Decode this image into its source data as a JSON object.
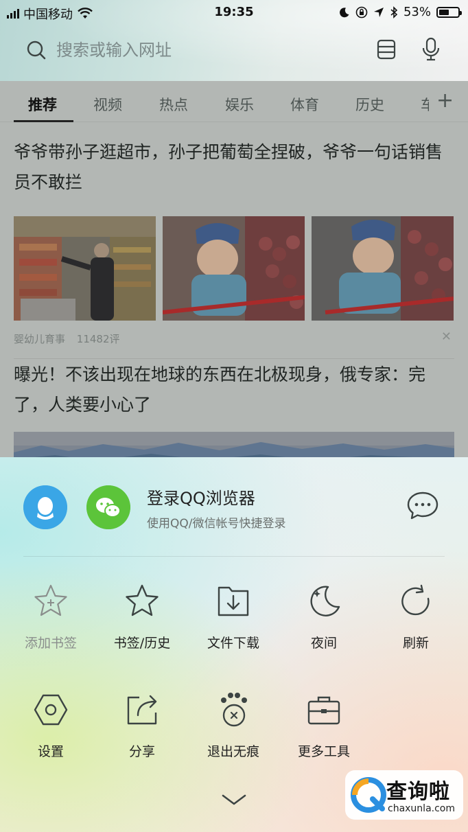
{
  "status_bar": {
    "carrier": "中国移动",
    "time": "19:35",
    "battery": "53%",
    "battery_level": 0.53
  },
  "search": {
    "placeholder": "搜索或输入网址"
  },
  "tabs": [
    {
      "label": "推荐",
      "active": true
    },
    {
      "label": "视频",
      "active": false
    },
    {
      "label": "热点",
      "active": false
    },
    {
      "label": "娱乐",
      "active": false
    },
    {
      "label": "体育",
      "active": false
    },
    {
      "label": "历史",
      "active": false
    },
    {
      "label": "车",
      "active": false
    }
  ],
  "feed": {
    "articles": [
      {
        "title": "爷爷带孙子逛超市，孙子把葡萄全捏破，爷爷一句话销售员不敢拦",
        "source": "婴幼儿育事",
        "comments": "11482评"
      },
      {
        "title": "曝光！不该出现在地球的东西在北极现身，俄专家：完了，人类要小心了"
      }
    ]
  },
  "login": {
    "title": "登录QQ浏览器",
    "subtitle": "使用QQ/微信帐号快捷登录"
  },
  "tools_row1": [
    {
      "label": "添加书签",
      "icon": "star-plus-icon",
      "enabled": false
    },
    {
      "label": "书签/历史",
      "icon": "star-icon",
      "enabled": true
    },
    {
      "label": "文件下载",
      "icon": "folder-download-icon",
      "enabled": true
    },
    {
      "label": "夜间",
      "icon": "moon-icon",
      "enabled": true
    },
    {
      "label": "刷新",
      "icon": "refresh-icon",
      "enabled": true
    }
  ],
  "tools_row2": [
    {
      "label": "设置",
      "icon": "hexagon-settings-icon",
      "enabled": true
    },
    {
      "label": "分享",
      "icon": "share-icon",
      "enabled": true
    },
    {
      "label": "退出无痕",
      "icon": "paw-incognito-icon",
      "enabled": true
    },
    {
      "label": "更多工具",
      "icon": "toolbox-icon",
      "enabled": true
    }
  ],
  "watermark": {
    "text": "查询啦",
    "url": "chaxunla.com"
  },
  "colors": {
    "qq_blue": "#3aa6e6",
    "wechat_green": "#5cc43a"
  }
}
